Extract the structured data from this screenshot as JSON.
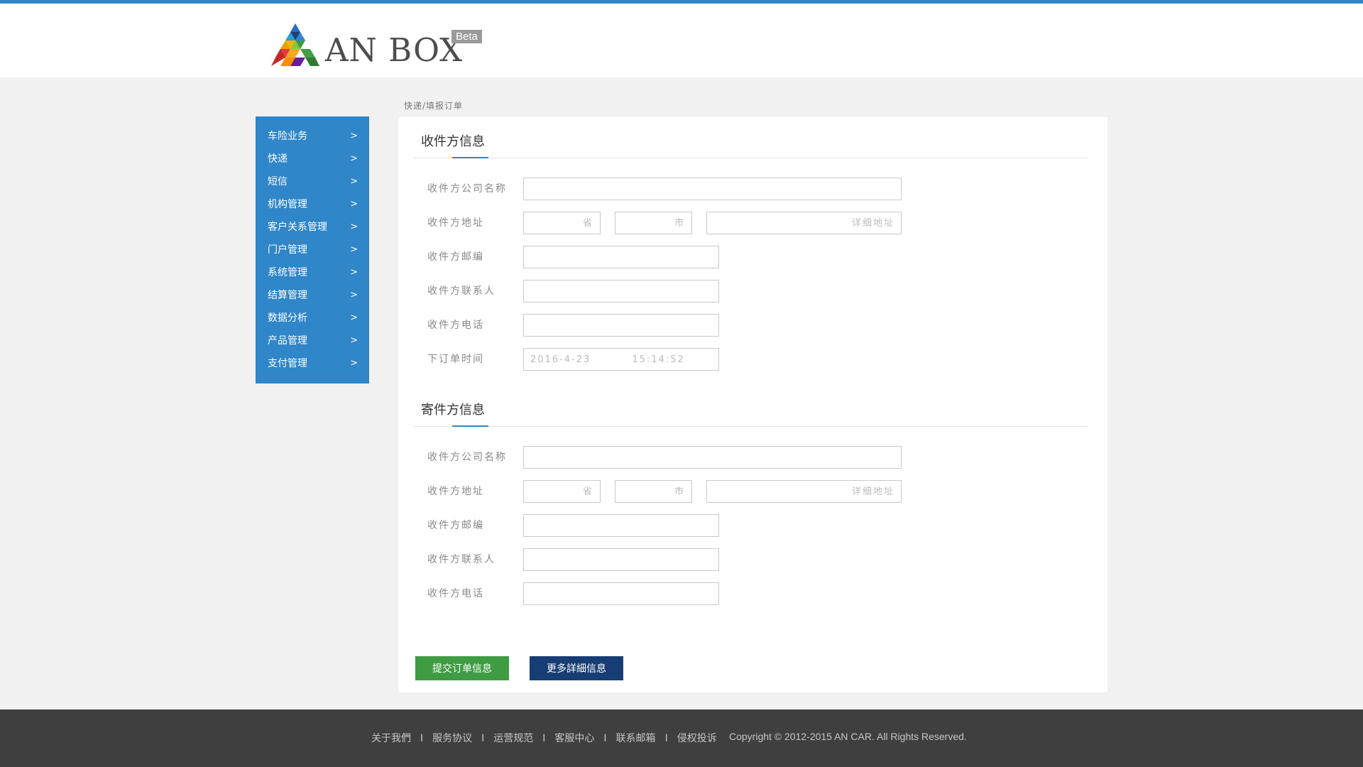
{
  "brand": {
    "name": "AN BOX",
    "badge": "Beta"
  },
  "sidebar": {
    "items": [
      {
        "label": "车险业务",
        "arrow": ">"
      },
      {
        "label": "快递",
        "arrow": ">"
      },
      {
        "label": "短信",
        "arrow": ">"
      },
      {
        "label": "机构管理",
        "arrow": ">"
      },
      {
        "label": "客户关系管理",
        "arrow": ">"
      },
      {
        "label": "门户管理",
        "arrow": ">"
      },
      {
        "label": "系统管理",
        "arrow": ">"
      },
      {
        "label": "结算管理",
        "arrow": ">"
      },
      {
        "label": "数据分析",
        "arrow": ">"
      },
      {
        "label": "产品管理",
        "arrow": ">"
      },
      {
        "label": "支付管理",
        "arrow": ">"
      }
    ]
  },
  "breadcrumb": "快递/填报订单",
  "receiver": {
    "title": "收件方信息",
    "company_label": "收件方公司名称",
    "address_label": "收件方地址",
    "province_placeholder": "省",
    "city_placeholder": "市",
    "detail_placeholder": "详细地址",
    "zip_label": "收件方邮编",
    "contact_label": "收件方联系人",
    "phone_label": "收件方电话",
    "order_time_label": "下订单时间",
    "order_time_value": "2016-4-23 15:14:52"
  },
  "sender": {
    "title": "寄件方信息",
    "company_label": "收件方公司名称",
    "address_label": "收件方地址",
    "province_placeholder": "省",
    "city_placeholder": "市",
    "detail_placeholder": "详细地址",
    "zip_label": "收件方邮编",
    "contact_label": "收件方联系人",
    "phone_label": "收件方电话"
  },
  "buttons": {
    "submit": "提交订单信息",
    "more": "更多詳細信息"
  },
  "footer": {
    "links": [
      "关于我們",
      "服务协议",
      "运营规范",
      "客服中心",
      "联系邮箱",
      "侵权投诉"
    ],
    "separator": "I",
    "copyright": "Copyright © 2012-2015 AN CAR.  All Rights Reserved."
  },
  "colors": {
    "accent": "#2f86c9",
    "submit_button": "#3f9c43",
    "more_button": "#173e74",
    "footer_bg": "#3f3f3f"
  }
}
